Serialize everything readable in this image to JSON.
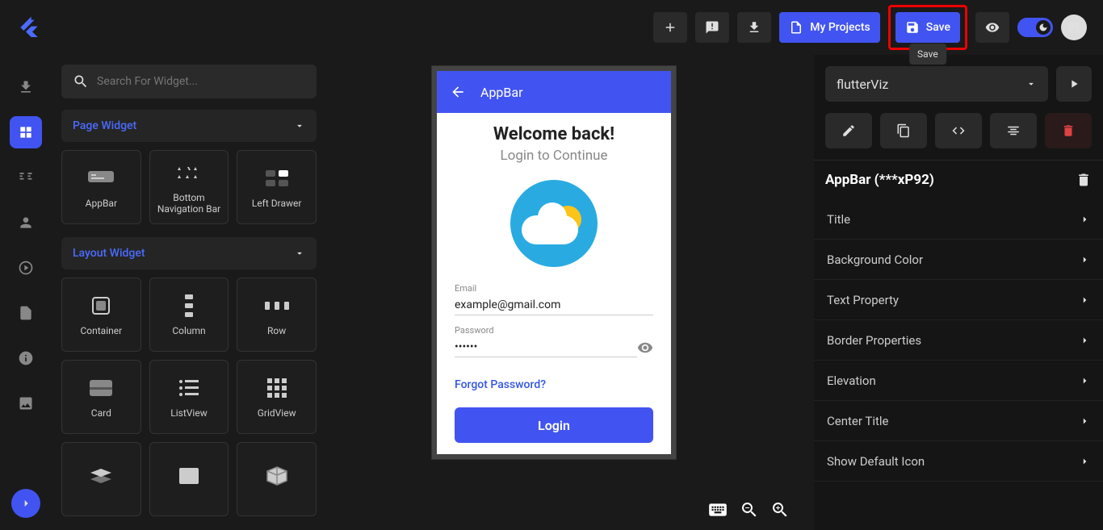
{
  "header": {
    "my_projects": "My Projects",
    "save": "Save",
    "save_tooltip": "Save"
  },
  "search": {
    "placeholder": "Search For Widget..."
  },
  "sections": {
    "page": "Page Widget",
    "layout": "Layout Widget"
  },
  "widgets": {
    "page": [
      {
        "name": "AppBar",
        "icon": "appbar"
      },
      {
        "name": "Bottom Navigation Bar",
        "icon": "bottomnav"
      },
      {
        "name": "Left Drawer",
        "icon": "drawer"
      }
    ],
    "layout": [
      {
        "name": "Container",
        "icon": "container"
      },
      {
        "name": "Column",
        "icon": "column"
      },
      {
        "name": "Row",
        "icon": "row"
      },
      {
        "name": "Card",
        "icon": "card"
      },
      {
        "name": "ListView",
        "icon": "listview"
      },
      {
        "name": "GridView",
        "icon": "gridview"
      },
      {
        "name": "",
        "icon": "stack"
      },
      {
        "name": "",
        "icon": "image"
      },
      {
        "name": "",
        "icon": "cube"
      }
    ]
  },
  "preview": {
    "appbar_title": "AppBar",
    "welcome": "Welcome back!",
    "subtitle": "Login to Continue",
    "email_label": "Email",
    "email_value": "example@gmail.com",
    "password_label": "Password",
    "password_value": "••••••",
    "forgot": "Forgot Password?",
    "login": "Login"
  },
  "props": {
    "screen_name": "flutterViz",
    "selected_widget": "AppBar (***xP92)",
    "items": [
      "Title",
      "Background Color",
      "Text Property",
      "Border Properties",
      "Elevation",
      "Center Title",
      "Show Default Icon"
    ]
  }
}
